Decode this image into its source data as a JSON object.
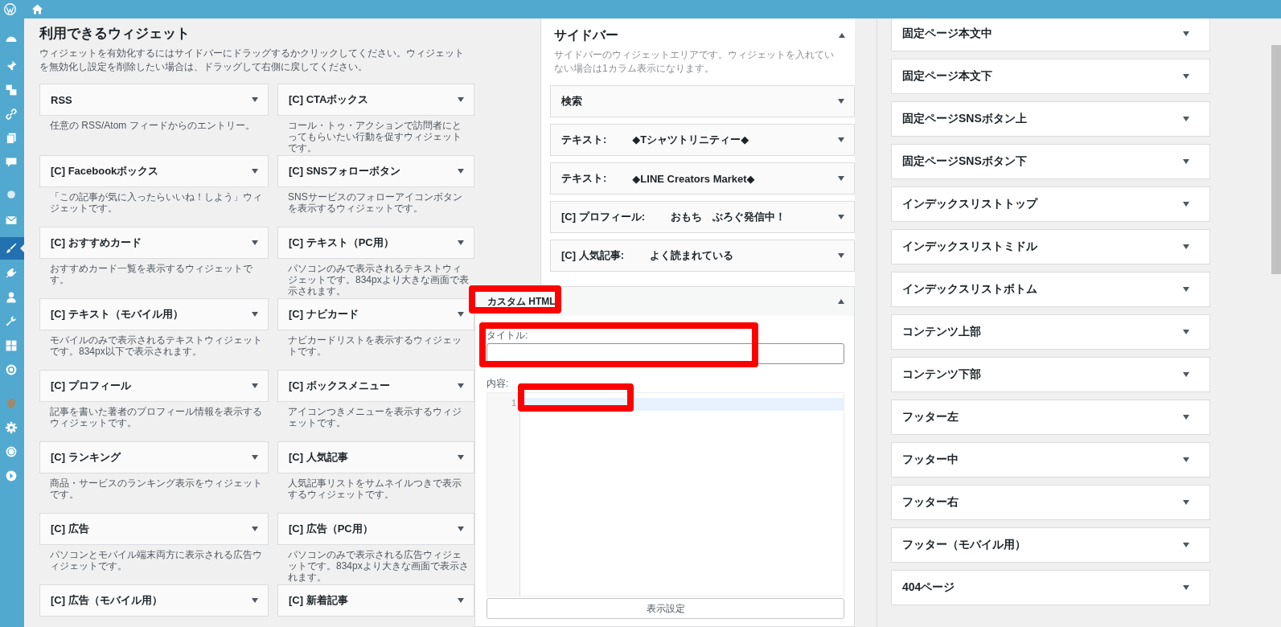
{
  "available_widgets": {
    "title": "利用できるウィジェット",
    "description": "ウィジェットを有効化するにはサイドバーにドラッグするかクリックしてください。ウィジェットを無効化し設定を削除したい場合は、ドラッグして右側に戻してください。",
    "items": [
      {
        "name": "RSS",
        "description": "任意の RSS/Atom フィードからのエントリー。"
      },
      {
        "name": "[C] CTAボックス",
        "description": "コール・トゥ・アクションで訪問者にとってもらいたい行動を促すウィジェットです。"
      },
      {
        "name": "[C] Facebookボックス",
        "description": "「この記事が気に入ったらいいね！しよう」ウィジェットです。"
      },
      {
        "name": "[C] SNSフォローボタン",
        "description": "SNSサービスのフォローアイコンボタンを表示するウィジェットです。"
      },
      {
        "name": "[C] おすすめカード",
        "description": "おすすめカード一覧を表示するウィジェットです。"
      },
      {
        "name": "[C] テキスト（PC用）",
        "description": "パソコンのみで表示されるテキストウィジェットです。834pxより大きな画面で表示されます。"
      },
      {
        "name": "[C] テキスト（モバイル用）",
        "description": "モバイルのみで表示されるテキストウィジェットです。834px以下で表示されます。"
      },
      {
        "name": "[C] ナビカード",
        "description": "ナビカードリストを表示するウィジェットです。"
      },
      {
        "name": "[C] プロフィール",
        "description": "記事を書いた著者のプロフィール情報を表示するウィジェットです。"
      },
      {
        "name": "[C] ボックスメニュー",
        "description": "アイコンつきメニューを表示するウィジェットです。"
      },
      {
        "name": "[C] ランキング",
        "description": "商品・サービスのランキング表示をウィジェットです。"
      },
      {
        "name": "[C] 人気記事",
        "description": "人気記事リストをサムネイルつきで表示するウィジェットです。"
      },
      {
        "name": "[C] 広告",
        "description": "パソコンとモバイル端末両方に表示される広告ウィジェットです。"
      },
      {
        "name": "[C] 広告（PC用）",
        "description": "パソコンのみで表示される広告ウィジェットです。834pxより大きな画面で表示されます。"
      },
      {
        "name": "[C] 広告（モバイル用）"
      },
      {
        "name": "[C] 新着記事"
      }
    ]
  },
  "sidebar_area": {
    "title": "サイドバー",
    "expanded": true,
    "description": "サイドバーのウィジェットエリアです。ウィジェットを入れていない場合は1カラム表示になります。",
    "widgets": [
      {
        "label": "検索",
        "expanded": false
      },
      {
        "label": "テキスト:",
        "title": "◆Tシャツトリニティー◆",
        "expanded": false
      },
      {
        "label": "テキスト:",
        "title": "◆LINE Creators Market◆",
        "expanded": false
      },
      {
        "label": "[C] プロフィール:",
        "title": "おもち　ぶろぐ発信中！",
        "expanded": false
      },
      {
        "label": "[C] 人気記事:",
        "title": "よく読まれている",
        "expanded": false
      }
    ]
  },
  "custom_html": {
    "label": "カスタム HTML",
    "expanded": true,
    "title_label": "タイトル:",
    "content_label": "内容:",
    "line_numbers": [
      "1"
    ],
    "settings_button": "表示設定"
  },
  "widget_areas": [
    {
      "name": "固定ページ本文中",
      "expanded": false
    },
    {
      "name": "固定ページ本文下",
      "expanded": false
    },
    {
      "name": "固定ページSNSボタン上",
      "expanded": false
    },
    {
      "name": "固定ページSNSボタン下",
      "expanded": false
    },
    {
      "name": "インデックスリストトップ",
      "expanded": false
    },
    {
      "name": "インデックスリストミドル",
      "expanded": false
    },
    {
      "name": "インデックスリストボトム",
      "expanded": false
    },
    {
      "name": "コンテンツ上部",
      "expanded": false
    },
    {
      "name": "コンテンツ下部",
      "expanded": false
    },
    {
      "name": "フッター左",
      "expanded": false
    },
    {
      "name": "フッター中",
      "expanded": false
    },
    {
      "name": "フッター右",
      "expanded": false
    },
    {
      "name": "フッター（モバイル用）",
      "expanded": false
    },
    {
      "name": "404ページ",
      "expanded": false
    }
  ]
}
